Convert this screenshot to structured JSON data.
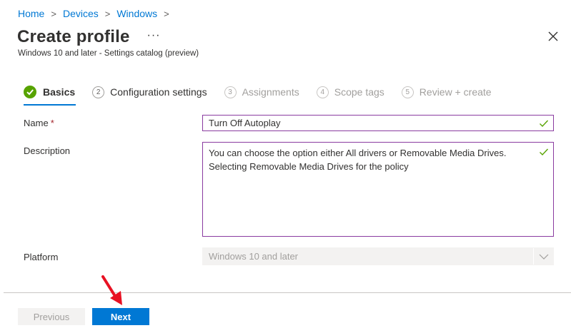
{
  "breadcrumb": {
    "items": [
      "Home",
      "Devices",
      "Windows"
    ],
    "separator": ">"
  },
  "header": {
    "title": "Create profile",
    "more_label": "···",
    "subtitle": "Windows 10 and later - Settings catalog (preview)",
    "close_icon": "close-icon"
  },
  "steps": [
    {
      "number": "",
      "label": "Basics",
      "state": "active"
    },
    {
      "number": "2",
      "label": "Configuration settings",
      "state": "next"
    },
    {
      "number": "3",
      "label": "Assignments",
      "state": "disabled"
    },
    {
      "number": "4",
      "label": "Scope tags",
      "state": "disabled"
    },
    {
      "number": "5",
      "label": "Review + create",
      "state": "disabled"
    }
  ],
  "form": {
    "name_label": "Name",
    "required_marker": "*",
    "name_value": "Turn Off Autoplay",
    "description_label": "Description",
    "description_value": "You can choose the option either All drivers or Removable Media Drives. Selecting Removable Media Drives for the policy",
    "platform_label": "Platform",
    "platform_value": "Windows 10 and later"
  },
  "footer": {
    "previous_label": "Previous",
    "next_label": "Next"
  },
  "colors": {
    "accent": "#0078d4",
    "success": "#57a300",
    "input_border": "#8a3ba0",
    "annotation_arrow": "#e81123"
  }
}
